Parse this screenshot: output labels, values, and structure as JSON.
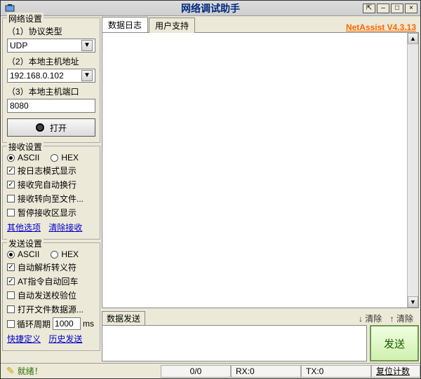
{
  "title": "网络调试助手",
  "version_label": "NetAssist V4.3.13",
  "window_controls": {
    "pin": "⇱",
    "min": "–",
    "max": "□",
    "close": "×"
  },
  "sidebar": {
    "net_group": {
      "legend": "网络设置",
      "protocol_label": "（1）协议类型",
      "protocol_value": "UDP",
      "host_label": "（2）本地主机地址",
      "host_value": "192.168.0.102",
      "port_label": "（3）本地主机端口",
      "port_value": "8080",
      "open_label": "打开"
    },
    "recv_group": {
      "legend": "接收设置",
      "ascii": "ASCII",
      "hex": "HEX",
      "opt1": "按日志模式显示",
      "opt2": "接收完自动换行",
      "opt3": "接收转向至文件...",
      "opt4": "暂停接收区显示",
      "link_more": "其他选项",
      "link_clear": "清除接收"
    },
    "send_group": {
      "legend": "发送设置",
      "ascii": "ASCII",
      "hex": "HEX",
      "opt1": "自动解析转义符",
      "opt2": "AT指令自动回车",
      "opt3": "自动发送校验位",
      "opt4": "打开文件数据源...",
      "opt5_prefix": "循环周期",
      "opt5_value": "1000",
      "opt5_suffix": "ms",
      "link_shortcut": "快捷定义",
      "link_history": "历史发送"
    }
  },
  "main": {
    "tab_log": "数据日志",
    "tab_support": "用户支持"
  },
  "send_area": {
    "tab": "数据发送",
    "link_clear1": "↓ 清除",
    "link_clear2": "↑ 清除",
    "send_btn": "发送"
  },
  "status": {
    "ready": "就绪！",
    "counter": "0/0",
    "rx": "RX:0",
    "tx": "TX:0",
    "reset": "复位计数"
  }
}
